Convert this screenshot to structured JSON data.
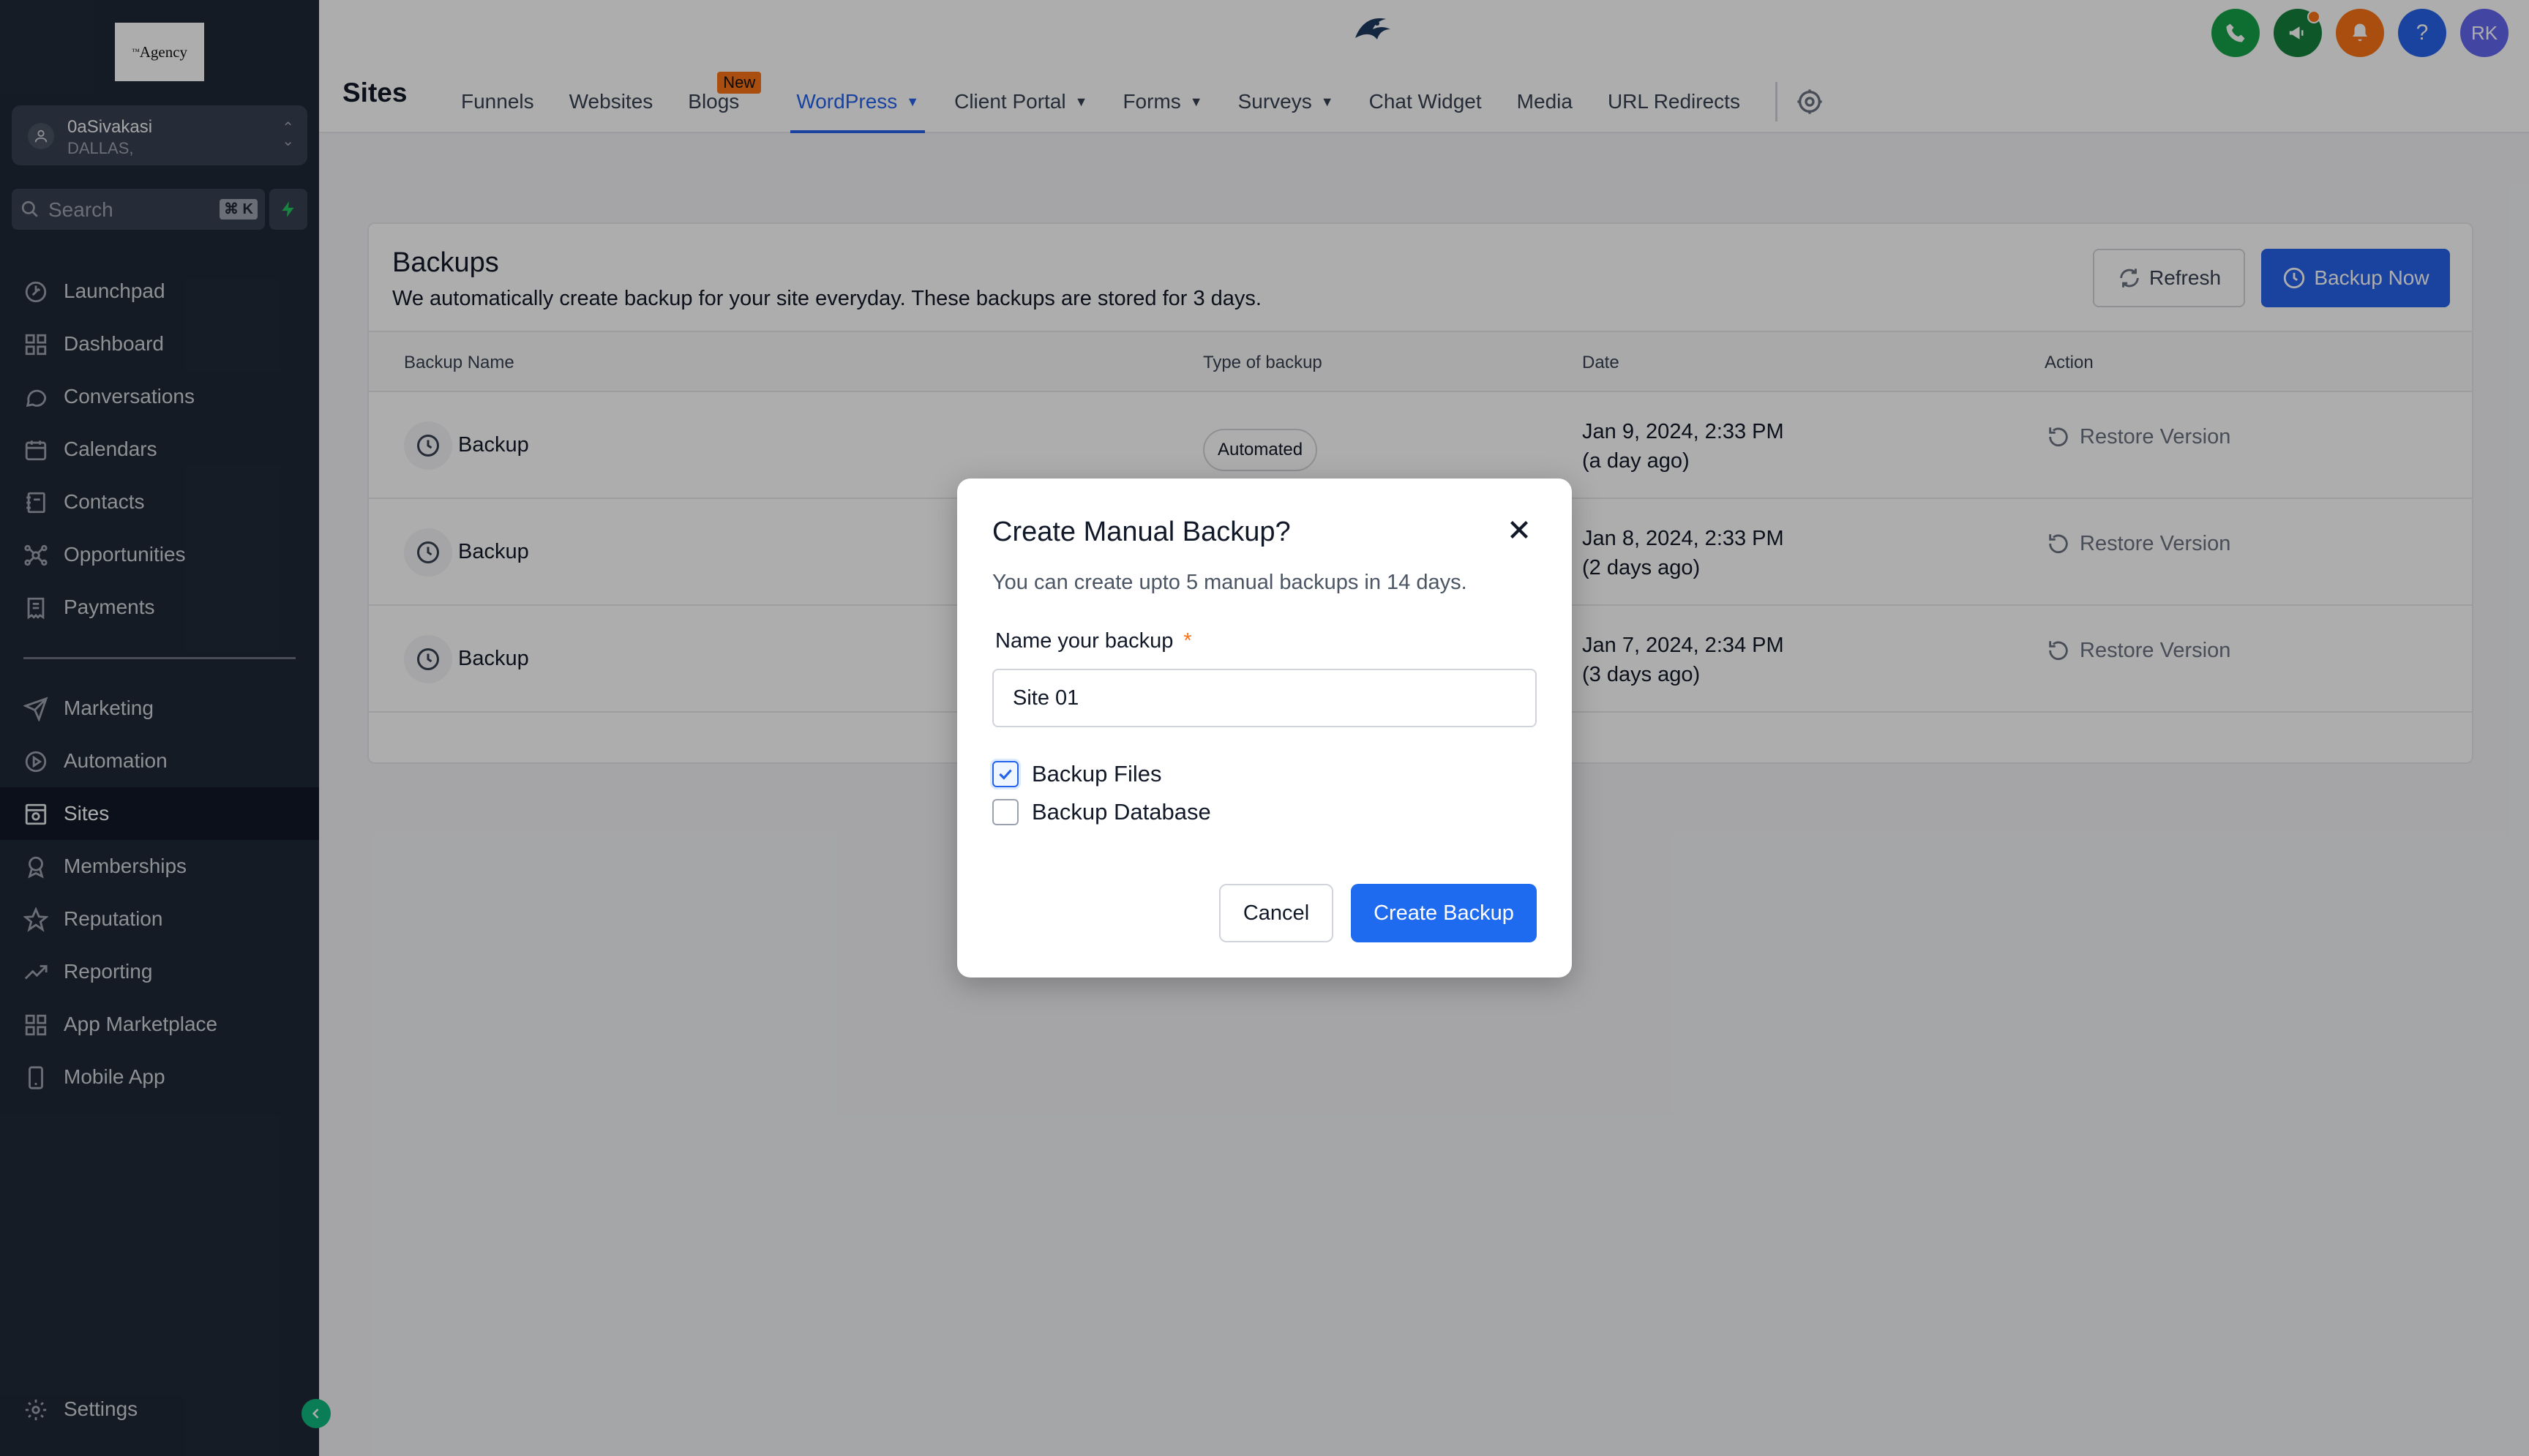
{
  "app": {
    "logo_text": "Agency",
    "logo_sup": "™"
  },
  "account": {
    "name": "0aSivakasi",
    "location": "DALLAS,"
  },
  "search": {
    "placeholder": "Search",
    "shortcut": "⌘ K"
  },
  "sidebar": {
    "items": [
      {
        "label": "Launchpad",
        "icon": "rocket-icon"
      },
      {
        "label": "Dashboard",
        "icon": "grid-icon"
      },
      {
        "label": "Conversations",
        "icon": "chat-bubble-icon"
      },
      {
        "label": "Calendars",
        "icon": "calendar-icon"
      },
      {
        "label": "Contacts",
        "icon": "contact-book-icon"
      },
      {
        "label": "Opportunities",
        "icon": "network-icon"
      },
      {
        "label": "Payments",
        "icon": "receipt-icon"
      },
      {
        "label": "Marketing",
        "icon": "send-icon"
      },
      {
        "label": "Automation",
        "icon": "automation-icon"
      },
      {
        "label": "Sites",
        "icon": "globe-window-icon",
        "active": true
      },
      {
        "label": "Memberships",
        "icon": "badge-icon"
      },
      {
        "label": "Reputation",
        "icon": "star-icon"
      },
      {
        "label": "Reporting",
        "icon": "trend-icon"
      },
      {
        "label": "App Marketplace",
        "icon": "apps-icon"
      },
      {
        "label": "Mobile App",
        "icon": "phone-icon"
      }
    ],
    "settings_label": "Settings"
  },
  "header": {
    "page_title": "Sites",
    "tabs": [
      {
        "label": "Funnels"
      },
      {
        "label": "Websites"
      },
      {
        "label": "Blogs",
        "badge": "New"
      },
      {
        "label": "WordPress",
        "dropdown": true,
        "active": true
      },
      {
        "label": "Client Portal",
        "dropdown": true
      },
      {
        "label": "Forms",
        "dropdown": true
      },
      {
        "label": "Surveys",
        "dropdown": true
      },
      {
        "label": "Chat Widget"
      },
      {
        "label": "Media"
      },
      {
        "label": "URL Redirects"
      }
    ],
    "avatar_initials": "RK",
    "help_glyph": "?"
  },
  "backups": {
    "title": "Backups",
    "subtitle": "We automatically create backup for your site everyday. These backups are stored for 3 days.",
    "refresh_label": "Refresh",
    "backup_now_label": "Backup Now",
    "columns": [
      "Backup Name",
      "Type of backup",
      "Date",
      "Action"
    ],
    "rows": [
      {
        "name": "Backup",
        "type": "Automated",
        "date": "Jan 9, 2024, 2:33 PM",
        "ago": "(a day ago)",
        "action": "Restore Version"
      },
      {
        "name": "Backup",
        "type": "",
        "date": "Jan 8, 2024, 2:33 PM",
        "ago": "(2 days ago)",
        "action": "Restore Version"
      },
      {
        "name": "Backup",
        "type": "",
        "date": "Jan 7, 2024, 2:34 PM",
        "ago": "(3 days ago)",
        "action": "Restore Version"
      }
    ]
  },
  "modal": {
    "title": "Create Manual Backup?",
    "description": "You can create upto 5 manual backups in 14 days.",
    "name_label": "Name your backup",
    "required_mark": "*",
    "name_value": "Site 01",
    "options": [
      {
        "label": "Backup Files",
        "checked": true
      },
      {
        "label": "Backup Database",
        "checked": false
      }
    ],
    "cancel_label": "Cancel",
    "create_label": "Create Backup"
  },
  "colors": {
    "sidebar_bg": "#1f2937",
    "accent": "#2563eb",
    "badge": "#f97316",
    "phone_btn": "#16a34a",
    "announce_btn": "#15803d",
    "bell_btn": "#f97316",
    "help_btn": "#2563eb",
    "avatar_btn": "#6366f1"
  }
}
